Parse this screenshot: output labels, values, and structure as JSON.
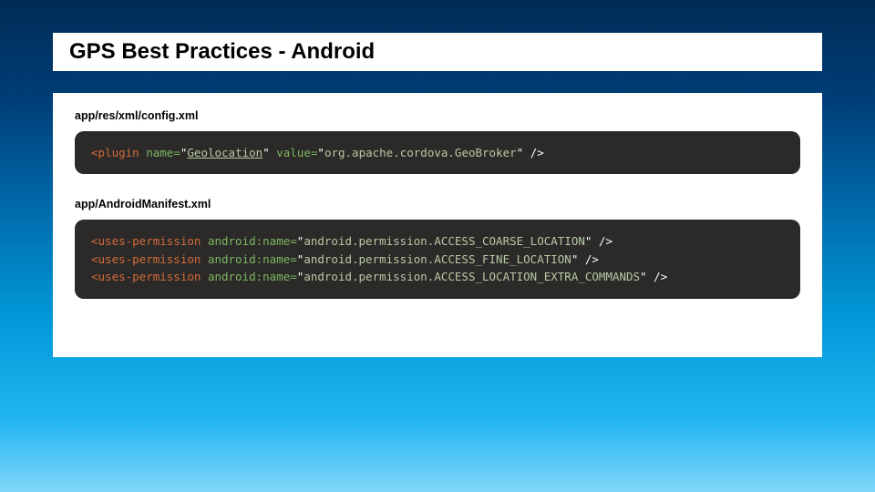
{
  "slide": {
    "title": "GPS Best Practices - Android"
  },
  "sections": [
    {
      "label": "app/res/xml/config.xml",
      "lines": [
        [
          {
            "cls": "tok-tag",
            "text": "<plugin"
          },
          {
            "cls": "tok-plain",
            "text": " "
          },
          {
            "cls": "tok-attr",
            "text": "name="
          },
          {
            "cls": "tok-plain",
            "text": "\""
          },
          {
            "cls": "tok-str tok-under",
            "text": "Geolocation"
          },
          {
            "cls": "tok-plain",
            "text": "\" "
          },
          {
            "cls": "tok-attr",
            "text": "value="
          },
          {
            "cls": "tok-plain",
            "text": "\""
          },
          {
            "cls": "tok-str",
            "text": "org.apache.cordova.GeoBroker"
          },
          {
            "cls": "tok-plain",
            "text": "\" />"
          }
        ]
      ]
    },
    {
      "label": "app/AndroidManifest.xml",
      "lines": [
        [
          {
            "cls": "tok-tag",
            "text": "<uses-permission"
          },
          {
            "cls": "tok-plain",
            "text": " "
          },
          {
            "cls": "tok-attr",
            "text": "android:name="
          },
          {
            "cls": "tok-plain",
            "text": "\""
          },
          {
            "cls": "tok-str",
            "text": "android.permission.ACCESS_COARSE_LOCATION"
          },
          {
            "cls": "tok-plain",
            "text": "\" />"
          }
        ],
        [
          {
            "cls": "tok-tag",
            "text": "<uses-permission"
          },
          {
            "cls": "tok-plain",
            "text": " "
          },
          {
            "cls": "tok-attr",
            "text": "android:name="
          },
          {
            "cls": "tok-plain",
            "text": "\""
          },
          {
            "cls": "tok-str",
            "text": "android.permission.ACCESS_FINE_LOCATION"
          },
          {
            "cls": "tok-plain",
            "text": "\" />"
          }
        ],
        [
          {
            "cls": "tok-tag",
            "text": "<uses-permission"
          },
          {
            "cls": "tok-plain",
            "text": " "
          },
          {
            "cls": "tok-attr",
            "text": "android:name="
          },
          {
            "cls": "tok-plain",
            "text": "\""
          },
          {
            "cls": "tok-str",
            "text": "android.permission.ACCESS_LOCATION_EXTRA_COMMANDS"
          },
          {
            "cls": "tok-plain",
            "text": "\" />"
          }
        ]
      ]
    }
  ]
}
